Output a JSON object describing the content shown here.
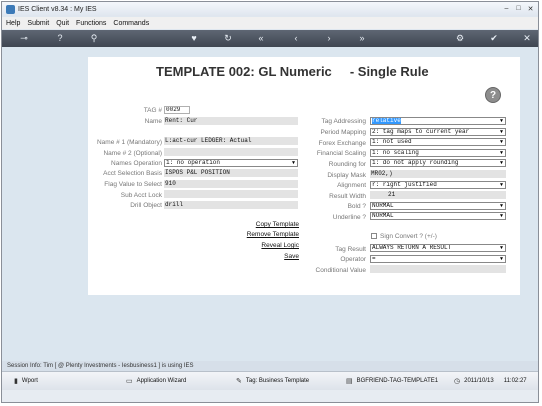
{
  "window": {
    "title": "IES Client v8.34 : My IES",
    "min": "–",
    "max": "□",
    "close": "✕"
  },
  "menu": [
    "Help",
    "Submit",
    "Quit",
    "Functions",
    "Commands"
  ],
  "toolbar": {
    "icons": [
      "key-icon",
      "help-icon",
      "search-icon",
      "heart-icon",
      "refresh-icon",
      "rewind-icon",
      "back-icon",
      "forward-icon",
      "fast-forward-icon",
      "gear-icon",
      "check-icon",
      "close-icon"
    ],
    "glyphs": [
      "⊸",
      "?",
      "⚲",
      "♥",
      "↻",
      "«",
      "‹",
      "›",
      "»",
      "⚙",
      "✔",
      "✕"
    ]
  },
  "page": {
    "heading": "TEMPLATE 002: GL Numeric     - Single Rule",
    "help": "?"
  },
  "left": {
    "tag_no": {
      "label": "TAG #",
      "value": "0029"
    },
    "name": {
      "label": "Name",
      "value": "Rent: Cur"
    },
    "name1": {
      "label": "Name # 1 (Mandatory)",
      "value": "L:act-cur LEDGER: Actual"
    },
    "name2": {
      "label": "Name # 2 (Optional)",
      "value": ""
    },
    "names_operation": {
      "label": "Names Operation",
      "value": "1: no operation"
    },
    "acct_basis": {
      "label": "Acct Selection Basis",
      "value": "ISPOS P&L POSITION"
    },
    "flag_value": {
      "label": "Flag Value to Select",
      "value": "910"
    },
    "sub_acct": {
      "label": "Sub Acct Lock",
      "value": ""
    },
    "drill": {
      "label": "Drill Object",
      "value": "drill"
    }
  },
  "links": {
    "copy": "Copy Template",
    "remove": "Remove Template",
    "reveal": "Reveal Logic",
    "save": "Save"
  },
  "right": {
    "tag_addressing": {
      "label": "Tag Addressing",
      "value": "relative"
    },
    "period_mapping": {
      "label": "Period Mapping",
      "value": "2: tag maps to current year"
    },
    "forex": {
      "label": "Forex Exchange",
      "value": "1: not used"
    },
    "financial_scaling": {
      "label": "Financial Scaling",
      "value": "1: no scaling"
    },
    "rounding": {
      "label": "Rounding for",
      "value": "1: do not apply rounding"
    },
    "display_mask": {
      "label": "Display Mask",
      "value": "MR02,)"
    },
    "alignment": {
      "label": "Alignment",
      "value": "r: right justified"
    },
    "result_width": {
      "label": "Result Width",
      "value": "21"
    },
    "bold": {
      "label": "Bold ?",
      "value": "NORMAL"
    },
    "underline": {
      "label": "Underline ?",
      "value": "NORMAL"
    },
    "sign_convert": {
      "label": "Sign Convert ? (+/-)"
    },
    "tag_result": {
      "label": "Tag Result",
      "value": "ALWAYS RETURN A RESULT"
    },
    "operator": {
      "label": "Operator",
      "value": "="
    },
    "conditional": {
      "label": "Conditional Value",
      "value": ""
    }
  },
  "status": "Session Info: Tim [ @ Plenty Investments - Iesbusiness1 ] is using IES",
  "taskbar": {
    "wport": "Wport",
    "wizard": "Application Wizard",
    "tag": "Tag: Business Template",
    "friend": "BGFRIEND-TAG-TEMPLATE1",
    "date": "2011/10/13",
    "time": "11:02:27"
  }
}
